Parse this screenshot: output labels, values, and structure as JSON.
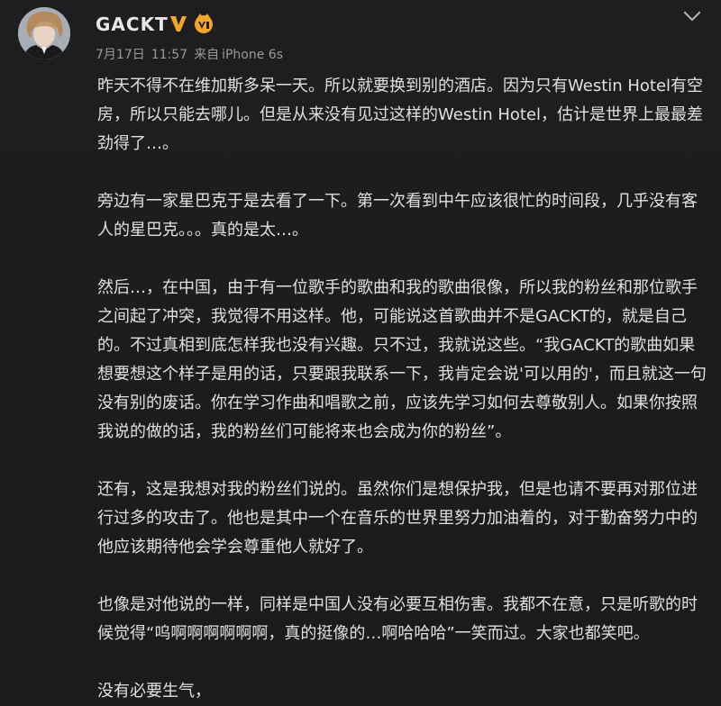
{
  "post": {
    "username": "GACKT",
    "date": "7月17日",
    "time": "11:57",
    "source_prefix": "来自",
    "source_device": "iPhone 6s",
    "paragraphs": [
      "昨天不得不在维加斯多呆一天。所以就要换到别的酒店。因为只有Westin Hotel有空房，所以只能去哪儿。但是从来没有见过这样的Westin Hotel，估计是世界上最最差劲得了…。",
      "旁边有一家星巴克于是去看了一下。第一次看到中午应该很忙的时间段，几乎没有客人的星巴克。。。真的是太…。",
      "然后…，在中国，由于有一位歌手的歌曲和我的歌曲很像，所以我的粉丝和那位歌手之间起了冲突，我觉得不用这样。他，可能说这首歌曲并不是GACKT的，就是自己的。不过真相到底怎样我也没有兴趣。只不过，我就说这些。“我GACKT的歌曲如果想要想这个样子是用的话，只要跟我联系一下，我肯定会说'可以用的'，而且就这一句没有别的废话。你在学习作曲和唱歌之前，应该先学习如何去尊敬别人。如果你按照我说的做的话，我的粉丝们可能将来也会成为你的粉丝”。",
      "还有，这是我想对我的粉丝们说的。虽然你们是想保护我，但是也请不要再对那位进行过多的攻击了。他也是其中一个在音乐的世界里努力加油着的，对于勤奋努力中的他应该期待他会学会尊重他人就好了。",
      "也像是对他说的一样，同样是中国人没有必要互相伤害。我都不在意，只是听歌的时候觉得“呜啊啊啊啊啊啊，真的挺像的…啊哈哈哈”一笑而过。大家也都笑吧。",
      "没有必要生气，"
    ]
  },
  "icons": {
    "verified": "verified-v-icon",
    "vip": "vip-crown-icon",
    "menu": "chevron-down-icon"
  },
  "colors": {
    "background": "#1c1c1e",
    "verified": "#f5a623",
    "vip": "#f5a623",
    "text": "#e0e0e0",
    "meta": "#9a9a9a"
  }
}
